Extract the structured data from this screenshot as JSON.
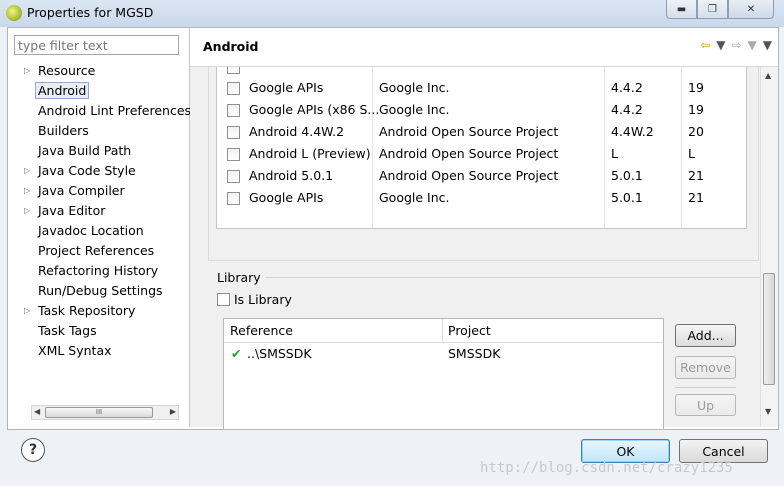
{
  "window": {
    "title": "Properties for MGSD",
    "controls": [
      "minimize-icon",
      "restore-icon",
      "close-icon"
    ]
  },
  "filter": {
    "placeholder": "type filter text"
  },
  "tree": {
    "items": [
      {
        "label": "Resource",
        "expandable": true
      },
      {
        "label": "Android",
        "expandable": false,
        "selected": true
      },
      {
        "label": "Android Lint Preferences",
        "expandable": false
      },
      {
        "label": "Builders",
        "expandable": false
      },
      {
        "label": "Java Build Path",
        "expandable": false
      },
      {
        "label": "Java Code Style",
        "expandable": true
      },
      {
        "label": "Java Compiler",
        "expandable": true
      },
      {
        "label": "Java Editor",
        "expandable": true
      },
      {
        "label": "Javadoc Location",
        "expandable": false
      },
      {
        "label": "Project References",
        "expandable": false
      },
      {
        "label": "Refactoring History",
        "expandable": false
      },
      {
        "label": "Run/Debug Settings",
        "expandable": false
      },
      {
        "label": "Task Repository",
        "expandable": true
      },
      {
        "label": "Task Tags",
        "expandable": false
      },
      {
        "label": "XML Syntax",
        "expandable": false
      }
    ],
    "scroll_thumb_grip": "III"
  },
  "page": {
    "title": "Android"
  },
  "api_table": {
    "rows": [
      {
        "name": "Google APIs",
        "vendor": "Google Inc.",
        "platform": "4.4.2",
        "api": "19"
      },
      {
        "name": "Google APIs (x86 S...",
        "vendor": "Google Inc.",
        "platform": "4.4.2",
        "api": "19"
      },
      {
        "name": "Android 4.4W.2",
        "vendor": "Android Open Source Project",
        "platform": "4.4W.2",
        "api": "20"
      },
      {
        "name": "Android L (Preview)",
        "vendor": "Android Open Source Project",
        "platform": "L",
        "api": "L"
      },
      {
        "name": "Android 5.0.1",
        "vendor": "Android Open Source Project",
        "platform": "5.0.1",
        "api": "21"
      },
      {
        "name": "Google APIs",
        "vendor": "Google Inc.",
        "platform": "5.0.1",
        "api": "21"
      }
    ]
  },
  "library": {
    "title": "Library",
    "is_library_label": "Is Library",
    "columns": [
      "Reference",
      "Project"
    ],
    "rows": [
      {
        "reference": "..\\SMSSDK",
        "project": "SMSSDK"
      }
    ],
    "buttons": {
      "add": "Add...",
      "remove": "Remove",
      "up": "Up"
    }
  },
  "dialog_buttons": {
    "ok": "OK",
    "cancel": "Cancel"
  },
  "watermark": "http://blog.csdn.net/crazy1235"
}
